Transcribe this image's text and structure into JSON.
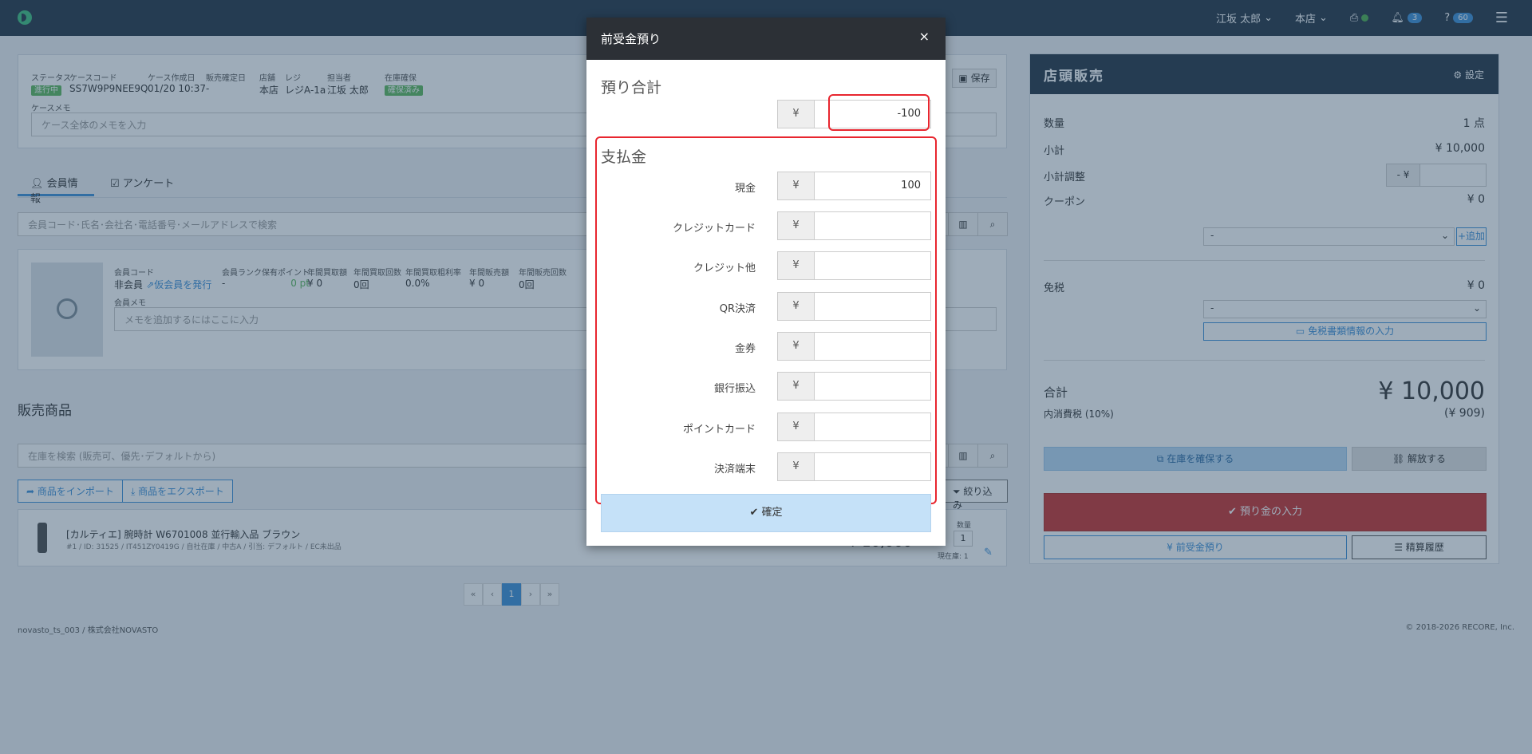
{
  "nav": {
    "user": "江坂 太郎",
    "store": "本店",
    "notifications": "3",
    "help": "60"
  },
  "case": {
    "status_label": "ステータス",
    "status_value": "進行中",
    "code_label": "ケースコード",
    "code_value": "SS7W9P9NEE9Q",
    "created_label": "ケース作成日",
    "created_value": "01/20 10:37",
    "sale_date_label": "販売確定日",
    "sale_date_value": "-",
    "shop_label": "店舗",
    "shop_value": "本店",
    "register_label": "レジ",
    "register_value": "レジA-1a",
    "staff_label": "担当者",
    "staff_value": "江坂 太郎",
    "stock_label": "在庫確保",
    "stock_value": "確保済み",
    "save_button": "保存",
    "memo_label": "ケースメモ",
    "memo_placeholder": "ケース全体のメモを入力"
  },
  "tabs": {
    "member": "会員情報",
    "survey": "アンケート"
  },
  "member": {
    "search_placeholder": "会員コード･氏名･会社名･電話番号･メールアドレスで検索",
    "code_label": "会員コード",
    "code_value": "非会員",
    "temp_register": "仮会員を発行",
    "rank_label": "会員ランク",
    "rank_value": "-",
    "points_label": "保有ポイント",
    "points_value": "0 pt",
    "annual_buy_label": "年間買取額",
    "annual_buy_value": "¥ 0",
    "annual_buy_count_label": "年間買取回数",
    "annual_buy_count_value": "0回",
    "annual_margin_label": "年間買取粗利率",
    "annual_margin_value": "0.0%",
    "annual_sales_label": "年間販売額",
    "annual_sales_value": "¥ 0",
    "annual_sales_count_label": "年間販売回数",
    "annual_sales_count_value": "0回",
    "memo_label": "会員メモ",
    "memo_placeholder": "メモを追加するにはここに入力"
  },
  "products": {
    "title": "販売商品",
    "search_placeholder": "在庫を検索 (販売可、優先･デフォルトから)",
    "import_button": "商品をインポート",
    "export_button": "商品をエクスポート",
    "filter_button": "絞り込み",
    "item_name": "[カルティエ] 腕時計 W6701008 並行輸入品 ブラウン",
    "item_meta": "#1 / ID: 31525 / IT451ZY0419G / 自社在庫 / 中古A / 引当: デフォルト / EC未出品",
    "item_price": "¥ 10,000",
    "qty_label": "数量",
    "qty_value": "1",
    "stock_now": "現在庫: 1"
  },
  "pagination": {
    "first": "«",
    "prev": "‹",
    "current": "1",
    "next": "›",
    "last": "»"
  },
  "footer": {
    "left": "novasto_ts_003 / 株式会社NOVASTO",
    "right": "© 2018-2026 RECORE, Inc."
  },
  "pos": {
    "title": "店頭販売",
    "settings": "設定",
    "qty_label": "数量",
    "qty_value": "1 点",
    "subtotal_label": "小計",
    "subtotal_value": "¥ 10,000",
    "adjust_label": "小計調整",
    "adjust_prefix": "- ¥",
    "coupon_label": "クーポン",
    "coupon_value": "¥ 0",
    "coupon_select": "-",
    "add_button": "追加",
    "taxfree_label": "免税",
    "taxfree_value": "¥ 0",
    "taxfree_select": "-",
    "taxfree_doc_button": "免税書類情報の入力",
    "total_label": "合計",
    "total_value": "¥ 10,000",
    "tax_label": "内消費税 (10%)",
    "tax_value": "(¥ 909)",
    "secure_stock_button": "在庫を確保する",
    "release_button": "解放する",
    "deposit_input_button": "預り金の入力",
    "advance_button": "¥ 前受金預り",
    "history_button": "精算履歴"
  },
  "modal": {
    "title": "前受金預り",
    "close": "×",
    "total_section": "預り合計",
    "currency": "¥",
    "total_value": "-100",
    "payment_section": "支払金",
    "payments": [
      {
        "label": "現金",
        "value": "100"
      },
      {
        "label": "クレジットカード",
        "value": ""
      },
      {
        "label": "クレジット他",
        "value": ""
      },
      {
        "label": "QR決済",
        "value": ""
      },
      {
        "label": "金券",
        "value": ""
      },
      {
        "label": "銀行振込",
        "value": ""
      },
      {
        "label": "ポイントカード",
        "value": ""
      },
      {
        "label": "決済端末",
        "value": ""
      }
    ],
    "confirm_button": "確定"
  },
  "colors": {
    "navbar": "#243444",
    "highlight": "#e8262f",
    "primary": "#3b8fd8",
    "danger": "#c9302c"
  }
}
